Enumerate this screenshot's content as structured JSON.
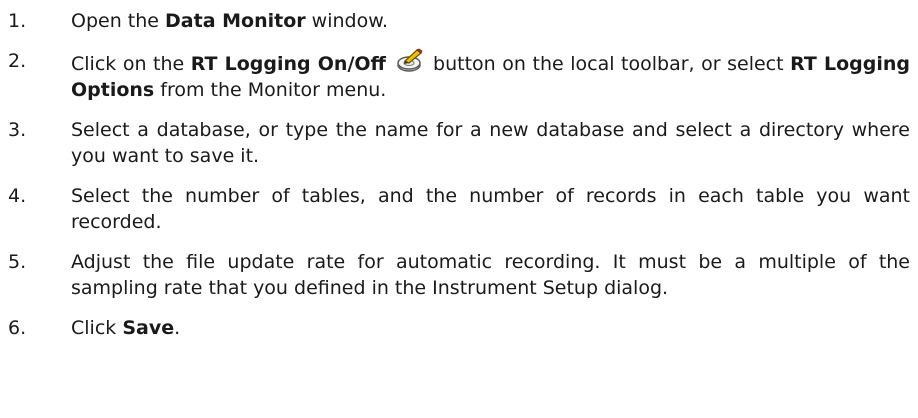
{
  "steps": [
    {
      "number": "1.",
      "before": "Open the ",
      "bold": "Data Monitor",
      "after": " window."
    },
    {
      "number": "2.",
      "before": "Click on the ",
      "bold": "RT Logging On/Off",
      "icon": "rt-logging-toolbar-icon",
      "middle": " button on the local toolbar, or select ",
      "bold2": "RT Logging Options",
      "after": " from the Monitor menu."
    },
    {
      "number": "3.",
      "text": "Select a database, or type the name for a new database and select a directory where you want to save it."
    },
    {
      "number": "4.",
      "text": "Select the number of tables, and the number of records in each table you want recorded."
    },
    {
      "number": "5.",
      "text": "Adjust the file update rate for automatic recording. It must be a multiple of the sampling rate that you defined in the Instrument Setup dialog."
    },
    {
      "number": "6.",
      "before": "Click ",
      "bold": "Save",
      "after": "."
    }
  ]
}
